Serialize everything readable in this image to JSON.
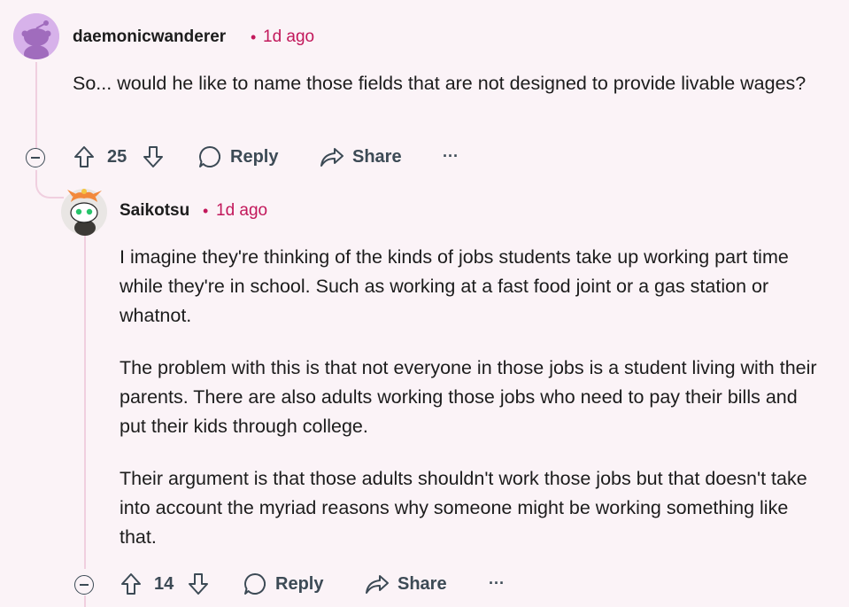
{
  "comments": [
    {
      "username": "daemonicwanderer",
      "separator": "•",
      "time": "1d ago",
      "body": [
        "So... would he like to name those fields that are not designed to provide livable wages?"
      ],
      "votes": "25",
      "reply_label": "Reply",
      "share_label": "Share",
      "more_label": "···",
      "avatar_icon": "snoo-avatar-icon"
    },
    {
      "username": "Saikotsu",
      "separator": "•",
      "time": "1d ago",
      "body": [
        "I imagine they're thinking of the kinds of jobs students take up working part time while they're in school. Such as working at a fast food joint or a gas station or whatnot.",
        "The problem with this is that not everyone in those jobs is a student living with their parents. There are also adults working those jobs who need to pay their bills and put their kids through college.",
        "Their argument is that those adults shouldn't work those jobs but that doesn't take into account the myriad reasons why someone might be working something like that."
      ],
      "votes": "14",
      "reply_label": "Reply",
      "share_label": "Share",
      "more_label": "···",
      "avatar_icon": "custom-snoo-avatar-icon"
    }
  ],
  "colors": {
    "background": "#fbf3f7",
    "thread_line": "#f0cfdf",
    "timestamp": "#c2185b",
    "action_text": "#3c4a55"
  }
}
